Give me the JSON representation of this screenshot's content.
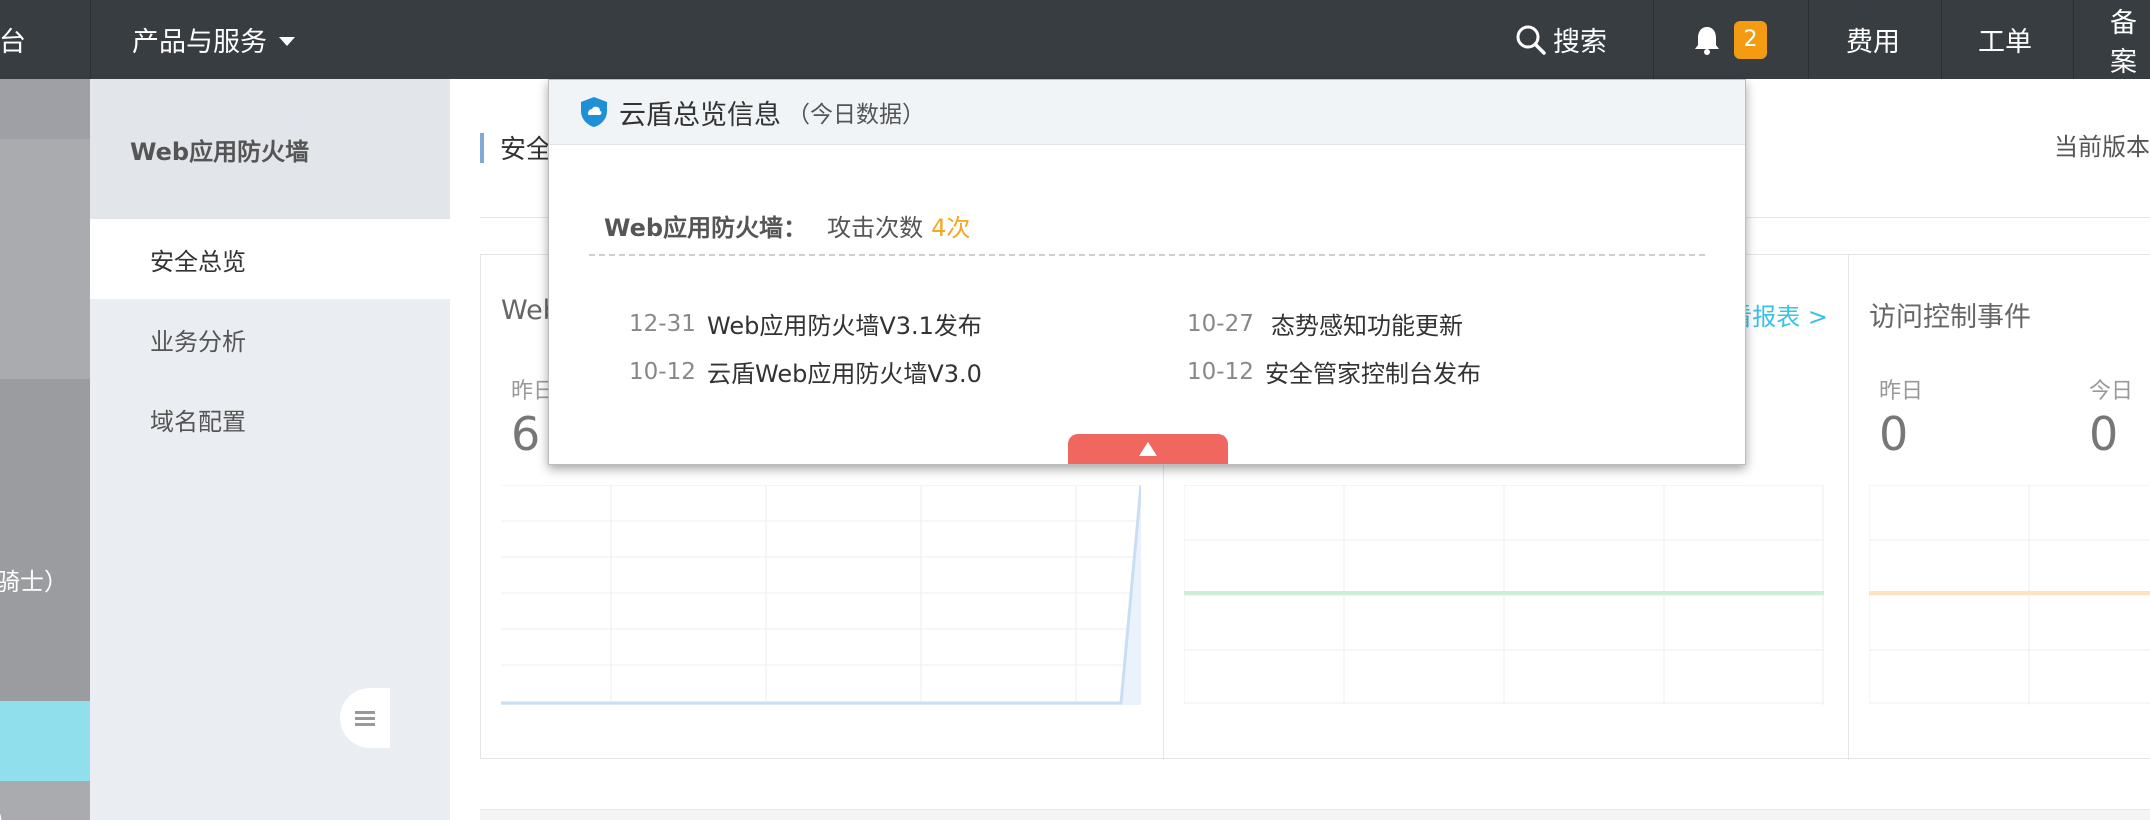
{
  "topbar": {
    "left_fragment": "制台",
    "products_label": "产品与服务",
    "search_label": "搜索",
    "notification_count": "2",
    "fees_label": "费用",
    "ticket_label": "工单",
    "beian_label": "备案"
  },
  "leftbar": {
    "fragment1": "骑士）",
    "fragment2": "）"
  },
  "subnav": {
    "title": "Web应用防火墙",
    "items": [
      {
        "label": "安全总览",
        "selected": true
      },
      {
        "label": "业务分析"
      },
      {
        "label": "域名配置"
      }
    ]
  },
  "main": {
    "title": "安全总览",
    "version": "当前版本",
    "cards": [
      {
        "title": "Web",
        "yesterday_label": "昨日",
        "yesterday_value": "6"
      },
      {
        "link": "看报表 >"
      },
      {
        "title": "访问控制事件",
        "yesterday_label": "昨日",
        "yesterday_value": "0",
        "today_label": "今日",
        "today_value": "0"
      }
    ]
  },
  "popup": {
    "title": "云盾总览信息",
    "subtitle": "（今日数据）",
    "stat_key": "Web应用防火墙：",
    "stat_label": "攻击次数",
    "stat_value": "4次",
    "news": [
      {
        "date": "12-31",
        "text": "Web应用防火墙V3.1发布"
      },
      {
        "date": "10-27",
        "text": "态势感知功能更新"
      },
      {
        "date": "10-12",
        "text": "云盾Web应用防火墙V3.0"
      },
      {
        "date": "10-12",
        "text": "安全管家控制台发布"
      }
    ]
  },
  "colors": {
    "topbar": "#373d41",
    "accent_orange": "#f5a623",
    "badge": "#f39c12",
    "link": "#39c0e8",
    "toggle": "#f0675f",
    "sidebar_active": "#8fe0ec"
  }
}
